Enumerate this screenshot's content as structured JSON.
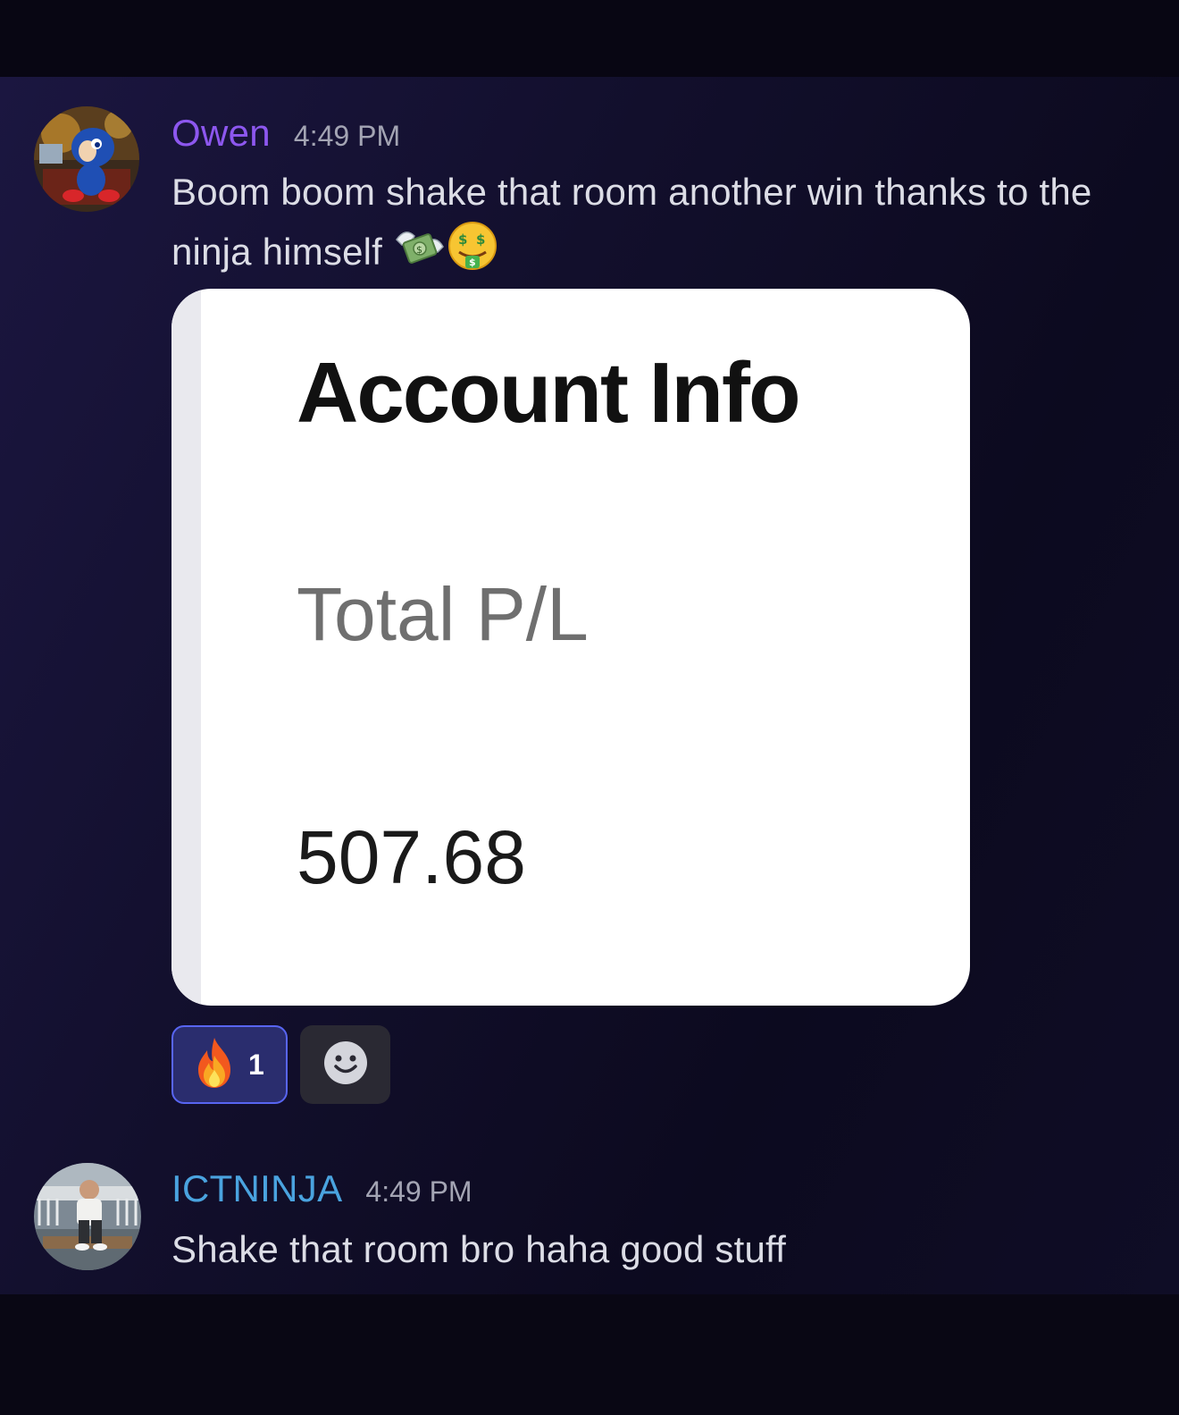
{
  "messages": [
    {
      "username": "Owen",
      "username_color": "#8d57ef",
      "timestamp": "4:49 PM",
      "text": "Boom boom shake that room another win thanks to the ninja himself",
      "emojis": [
        "money-with-wings-icon",
        "money-mouth-face-icon"
      ],
      "attachment": {
        "title": "Account Info",
        "label": "Total P/L",
        "value": "507.68"
      },
      "reactions": [
        {
          "emoji": "fire-icon",
          "count": "1",
          "reacted": true
        }
      ]
    },
    {
      "username": "ICTNINJA",
      "username_color": "#4aa3df",
      "timestamp": "4:49 PM",
      "text": "Shake that room bro haha good stuff"
    }
  ],
  "colors": {
    "reaction_border": "#5865f2",
    "reaction_bg": "#2a2d6e",
    "text": "#dcdde6",
    "timestamp": "#a3a4b3"
  }
}
